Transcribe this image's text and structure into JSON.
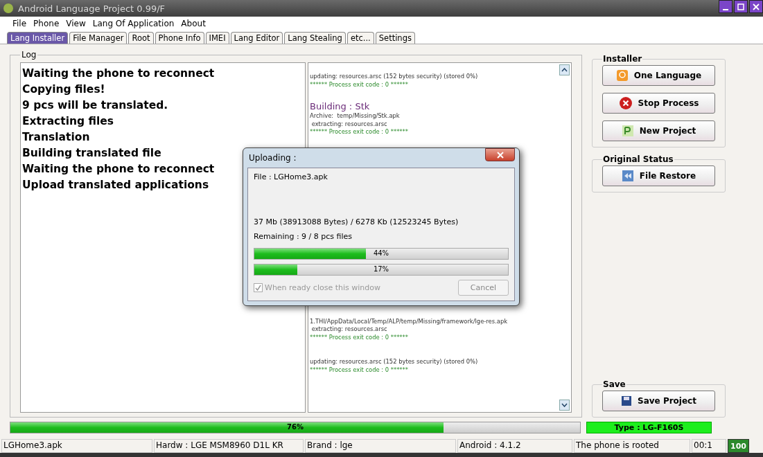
{
  "window": {
    "title": "Android Language Project 0.99/F"
  },
  "menu": [
    "File",
    "Phone",
    "View",
    "Lang Of Application",
    "About"
  ],
  "tabs": [
    {
      "label": "Lang Installer",
      "selected": true
    },
    {
      "label": "File Manager",
      "selected": false
    },
    {
      "label": "Root",
      "selected": false
    },
    {
      "label": "Phone Info",
      "selected": false
    },
    {
      "label": "IMEI",
      "selected": false
    },
    {
      "label": "Lang Editor",
      "selected": false
    },
    {
      "label": "Lang Stealing",
      "selected": false
    },
    {
      "label": "etc...",
      "selected": false
    },
    {
      "label": "Settings",
      "selected": false
    }
  ],
  "log": {
    "title": "Log",
    "steps": [
      "Waiting the phone to reconnect",
      "Copying files!",
      "9 pcs will be translated.",
      "Extracting files",
      "Translation",
      "Building translated file",
      "Waiting the phone to reconnect",
      "Upload translated applications"
    ],
    "output_top": [
      {
        "kind": "plain",
        "text": "updating: resources.arsc (152 bytes security) (stored 0%)"
      },
      {
        "kind": "exit",
        "text": "****** Process exit code : 0 ******"
      },
      {
        "kind": "heading",
        "text": "Building : Stk"
      },
      {
        "kind": "plain",
        "text": "Archive:  temp/Missing/Stk.apk"
      },
      {
        "kind": "plain",
        "text": " extracting: resources.arsc"
      },
      {
        "kind": "exit",
        "text": "****** Process exit code : 0 ******"
      }
    ],
    "output_bottom": [
      {
        "kind": "plain",
        "text": "1.THI/AppData/Local/Temp/ALP/temp/Missing/framework/lge-res.apk"
      },
      {
        "kind": "plain",
        "text": " extracting: resources.arsc"
      },
      {
        "kind": "exit",
        "text": "****** Process exit code : 0 ******"
      },
      {
        "kind": "plain",
        "text": "updating: resources.arsc (152 bytes security) (stored 0%)"
      },
      {
        "kind": "exit",
        "text": "****** Process exit code : 0 ******"
      }
    ]
  },
  "groups": [
    {
      "title": "Installer",
      "buttons": [
        "One Language",
        "Stop Process",
        "New Project"
      ]
    },
    {
      "title": "Original Status",
      "buttons": [
        "File Restore"
      ]
    }
  ],
  "save": {
    "title": "Save",
    "button": "Save Project"
  },
  "progress": {
    "level": 0.76,
    "label": "76%"
  },
  "device_type": "Type : LG-F160S",
  "status_bar": [
    "LGHome3.apk",
    "Hardw : LGE MSM8960 D1L KR",
    "Brand : lge",
    "Android : 4.1.2",
    "The phone is rooted",
    "00:1"
  ],
  "battery": "100",
  "dialog": {
    "title": "Uploading :",
    "file": "File : LGHome3.apk",
    "size": "37 Mb (38913088 Bytes) / 6278 Kb (12523245 Bytes)",
    "remaining": "Remaining : 9 / 8 pcs files",
    "bars": [
      {
        "level": 0.44,
        "label": "44%"
      },
      {
        "level": 0.17,
        "label": "17%"
      }
    ],
    "close_when_ready": {
      "label": "When ready close this window",
      "checked": true,
      "disabled": true
    },
    "cancel": {
      "label": "Cancel",
      "disabled": true
    }
  }
}
